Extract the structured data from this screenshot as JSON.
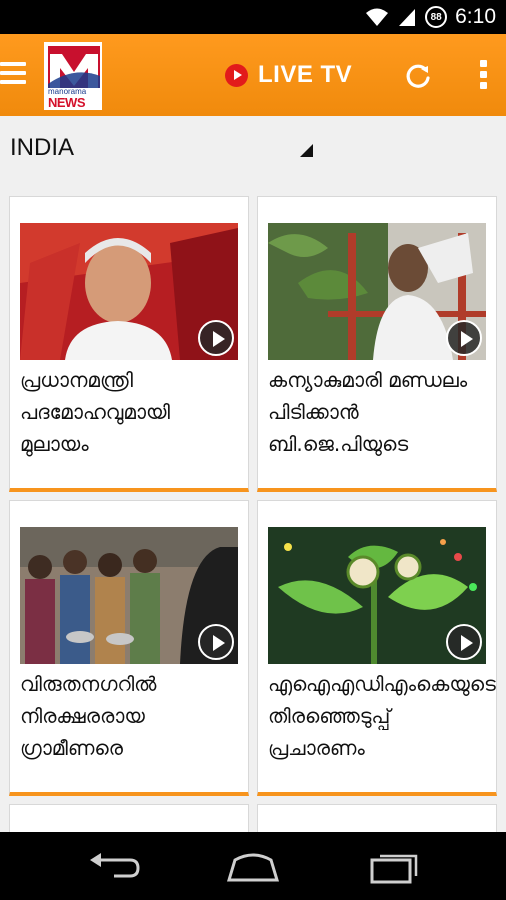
{
  "status_bar": {
    "time": "6:10",
    "battery_level": "88",
    "icons": [
      "wifi-icon",
      "signal-icon",
      "battery-icon"
    ]
  },
  "app_bar": {
    "logo_brand": "manorama",
    "logo_news": "NEWS",
    "live_tv_label": "LIVE TV",
    "background": "#f7941d",
    "live_dot_color": "#e21b1b"
  },
  "section": {
    "title": "INDIA"
  },
  "cards": [
    {
      "headline": "പ്രധാനമന്ത്രി പദമോഹവുമായി മുലായം",
      "has_video": true,
      "image": "politician-portrait"
    },
    {
      "headline": "കന്യാകുമാരി മണ്ഡലം പിടിക്കാൻ ബി.ജെ.പിയുടെ",
      "has_video": true,
      "image": "man-on-stage"
    },
    {
      "headline": "വിരുതനഗറിൽ നിരക്ഷരരായ ഗ്രാമീണരെ",
      "has_video": true,
      "image": "village-crowd"
    },
    {
      "headline": "എഐഎഡിഎംകെയുടെ തിരഞ്ഞെടുപ്പ് പ്രചാരണം",
      "has_video": true,
      "image": "party-symbol-leaves"
    }
  ],
  "nav_bar": {
    "buttons": [
      "back-icon",
      "home-icon",
      "recents-icon"
    ]
  },
  "colors": {
    "accent": "#f7941d",
    "brand_red": "#c8102e",
    "brand_blue": "#1a3b8c"
  }
}
